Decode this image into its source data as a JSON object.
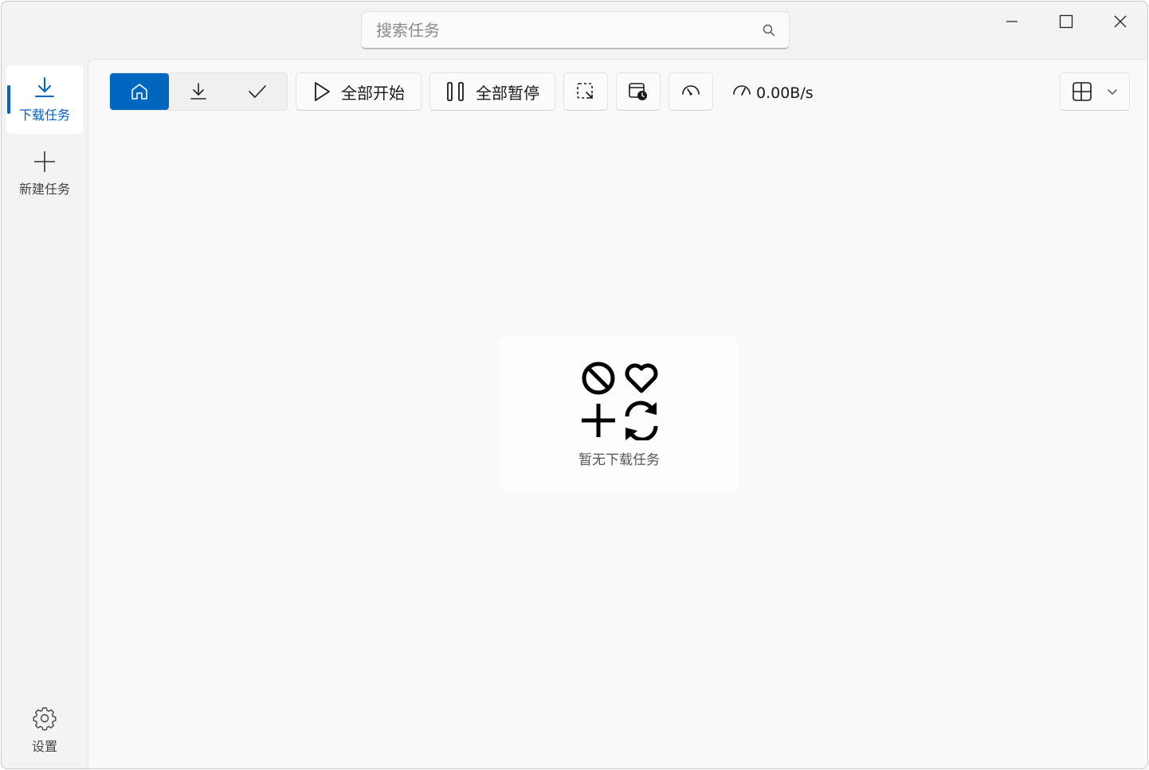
{
  "search": {
    "placeholder": "搜索任务"
  },
  "window_controls": [
    "minimize-icon",
    "maximize-icon",
    "close-icon"
  ],
  "sidebar": {
    "items": [
      {
        "label": "下载任务",
        "icon": "download-icon",
        "active": true
      },
      {
        "label": "新建任务",
        "icon": "plus-icon",
        "active": false
      }
    ],
    "settings_label": "设置"
  },
  "toolbar": {
    "filters": [
      {
        "icon": "home-icon",
        "selected": true
      },
      {
        "icon": "download-icon",
        "selected": false
      },
      {
        "icon": "check-icon",
        "selected": false
      }
    ],
    "start_all_label": "全部开始",
    "pause_all_label": "全部暂停",
    "speed": "0.00B/s"
  },
  "empty_state": {
    "text": "暂无下载任务"
  },
  "colors": {
    "accent": "#0067c0"
  }
}
